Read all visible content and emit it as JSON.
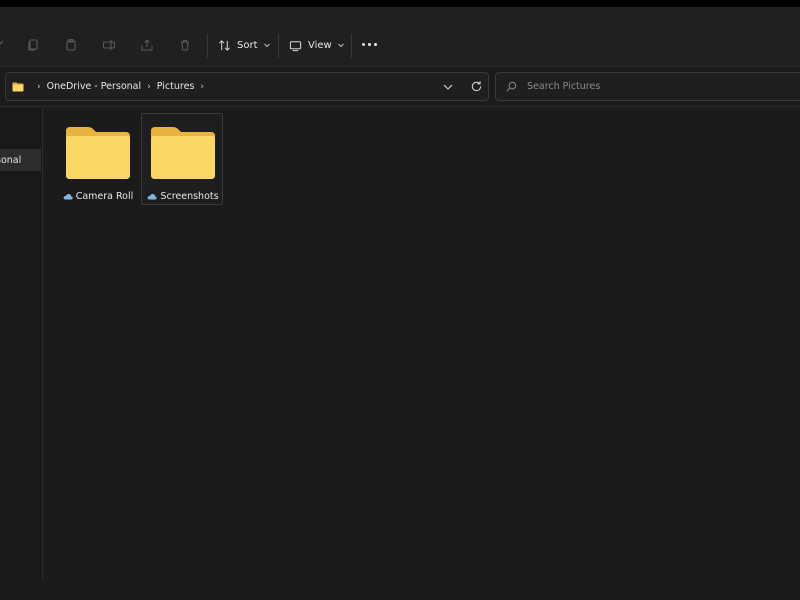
{
  "toolbar": {
    "icons": [
      "copy-icon",
      "paste-icon",
      "rename-icon",
      "share-icon",
      "delete-icon"
    ],
    "sort_label": "Sort",
    "view_label": "View",
    "more": "more-options-icon"
  },
  "address": {
    "crumbs": [
      "OneDrive - Personal",
      "Pictures"
    ],
    "separator": "›"
  },
  "search": {
    "placeholder": "Search Pictures"
  },
  "nav": {
    "selected_label": "sonal"
  },
  "items": [
    {
      "name": "Camera Roll",
      "status": "cloud-icon",
      "selected": false
    },
    {
      "name": "Screenshots",
      "status": "cloud-icon",
      "selected": true
    }
  ],
  "colors": {
    "folder_back": "#e9b43d",
    "folder_front": "#fcd766",
    "cloud": "#7fb7e6",
    "background": "#1b1b1b"
  }
}
